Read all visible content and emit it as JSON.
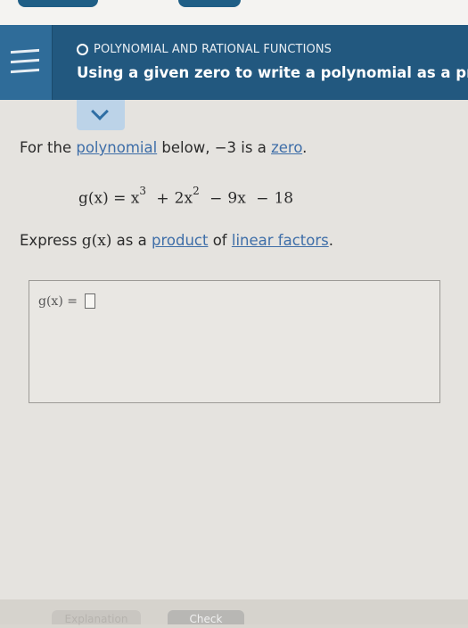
{
  "header": {
    "topic": "POLYNOMIAL AND RATIONAL FUNCTIONS",
    "title": "Using a given zero to write a polynomial as a pro"
  },
  "problem": {
    "intro_pre": "For the ",
    "intro_link1": "polynomial",
    "intro_mid": " below, ",
    "zero_value": "−3",
    "intro_mid2": " is a ",
    "intro_link2": "zero",
    "intro_end": ".",
    "equation": {
      "lhs": "g(x) = x",
      "exp1": "3",
      "plus1": "+",
      "term2": "2x",
      "exp2": "2",
      "minus1": "−",
      "term3": "9x",
      "minus2": "−",
      "term4": "18"
    },
    "express_pre": "Express ",
    "express_func": "g(x)",
    "express_mid": " as a ",
    "express_link1": "product",
    "express_of": " of ",
    "express_link2": "linear factors",
    "express_end": "."
  },
  "answer": {
    "label": "g(x) ="
  },
  "buttons": {
    "explanation": "Explanation",
    "check": "Check"
  }
}
